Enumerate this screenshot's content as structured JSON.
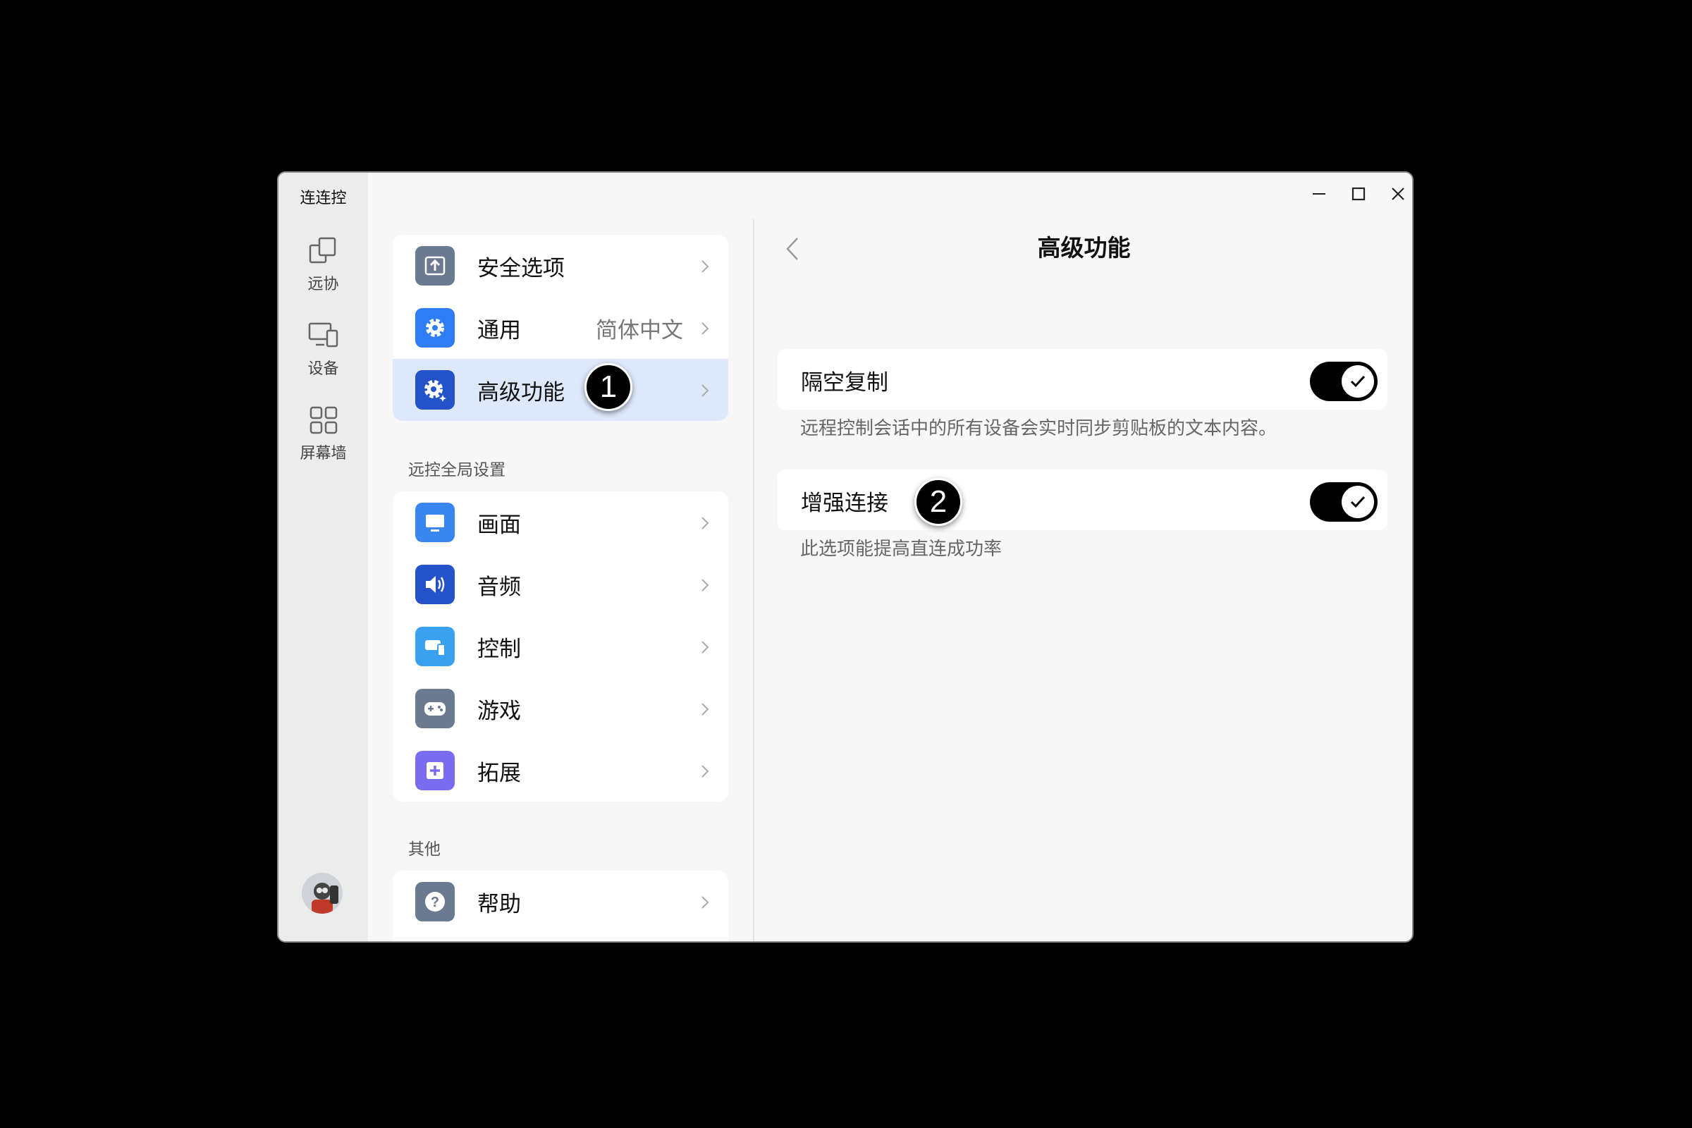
{
  "app": {
    "title": "连连控"
  },
  "rail": {
    "items": [
      {
        "label": "远协"
      },
      {
        "label": "设备"
      },
      {
        "label": "屏幕墙"
      }
    ]
  },
  "menu": {
    "top": [
      {
        "label": "安全选项",
        "value": ""
      },
      {
        "label": "通用",
        "value": "简体中文"
      },
      {
        "label": "高级功能",
        "value": "",
        "active": true
      }
    ],
    "section1": "远控全局设置",
    "global": [
      {
        "label": "画面"
      },
      {
        "label": "音频"
      },
      {
        "label": "控制"
      },
      {
        "label": "游戏"
      },
      {
        "label": "拓展"
      }
    ],
    "section2": "其他",
    "other": [
      {
        "label": "帮助"
      }
    ]
  },
  "detail": {
    "title": "高级功能",
    "settings": [
      {
        "label": "隔空复制",
        "enabled": true,
        "description": "远程控制会话中的所有设备会实时同步剪贴板的文本内容。"
      },
      {
        "label": "增强连接",
        "enabled": true,
        "description": "此选项能提高直连成功率"
      }
    ]
  },
  "annotations": [
    "1",
    "2"
  ],
  "colors": {
    "active_row": "#dde9fb",
    "icon_security": "#6b7a90",
    "icon_general": "#2e7cf6",
    "icon_advanced": "#2452c9",
    "icon_display": "#3a86f0",
    "icon_audio": "#2452c9",
    "icon_control": "#3aa0f0",
    "icon_game": "#6b7a90",
    "icon_extend": "#7a6cf0",
    "icon_help": "#6b7a90",
    "toggle_on": "#000000"
  }
}
